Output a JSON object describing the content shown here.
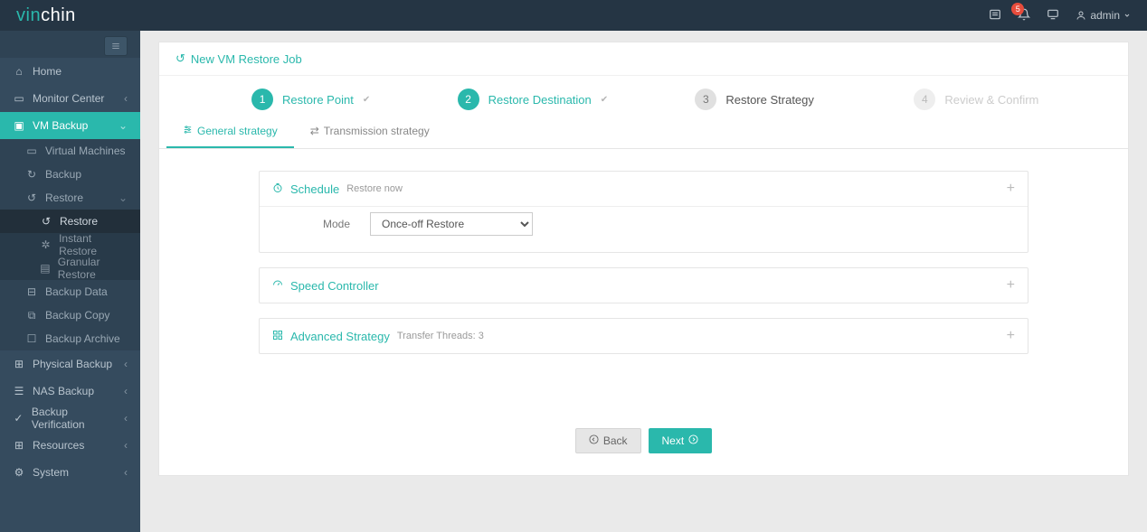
{
  "header": {
    "brand_vin": "vin",
    "brand_chin": "chin",
    "notif_count": "5",
    "user_label": "admin"
  },
  "sidebar": {
    "items": [
      {
        "label": "Home"
      },
      {
        "label": "Monitor Center"
      },
      {
        "label": "VM Backup"
      },
      {
        "label": "Physical Backup"
      },
      {
        "label": "NAS Backup"
      },
      {
        "label": "Backup Verification"
      },
      {
        "label": "Resources"
      },
      {
        "label": "System"
      }
    ],
    "vm_sub": [
      {
        "label": "Virtual Machines"
      },
      {
        "label": "Backup"
      },
      {
        "label": "Restore"
      },
      {
        "label": "Backup Data"
      },
      {
        "label": "Backup Copy"
      },
      {
        "label": "Backup Archive"
      }
    ],
    "restore_sub": [
      {
        "label": "Restore"
      },
      {
        "label": "Instant Restore"
      },
      {
        "label": "Granular Restore"
      }
    ]
  },
  "page": {
    "title": "New VM Restore Job",
    "steps": [
      {
        "num": "1",
        "label": "Restore Point"
      },
      {
        "num": "2",
        "label": "Restore Destination"
      },
      {
        "num": "3",
        "label": "Restore Strategy"
      },
      {
        "num": "4",
        "label": "Review & Confirm"
      }
    ],
    "tabs": [
      {
        "label": "General strategy"
      },
      {
        "label": "Transmission strategy"
      }
    ],
    "panels": {
      "schedule": {
        "title": "Schedule",
        "sub": "Restore now",
        "mode_label": "Mode",
        "mode_value": "Once-off Restore"
      },
      "speed": {
        "title": "Speed Controller"
      },
      "advanced": {
        "title": "Advanced Strategy",
        "sub": "Transfer Threads: 3"
      }
    },
    "buttons": {
      "back": "Back",
      "next": "Next"
    }
  }
}
